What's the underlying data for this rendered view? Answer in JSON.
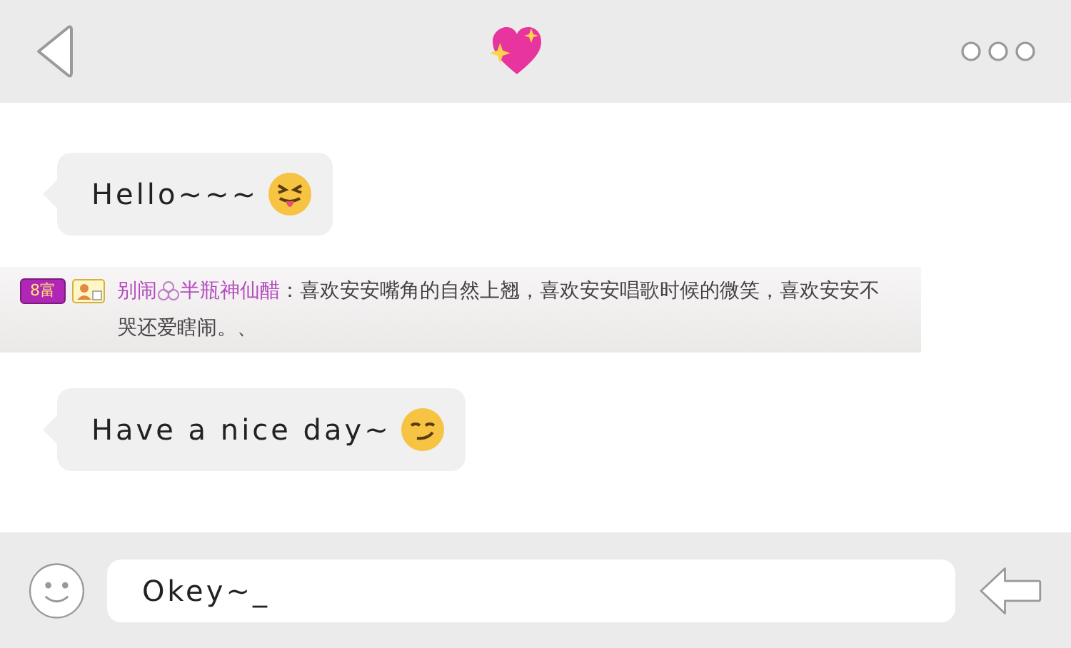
{
  "messages": [
    {
      "kind": "bubble",
      "text": "Hello~~~"
    },
    {
      "kind": "comment",
      "badge": "8富",
      "user": "别闹",
      "nickname": "半瓶神仙醋",
      "text": "：喜欢安安嘴角的自然上翘，喜欢安安唱歌时候的微笑，喜欢安安不哭还爱瞎闹。、"
    },
    {
      "kind": "bubble",
      "text": "Have a nice day~"
    }
  ],
  "input": {
    "value": "Okey~_"
  }
}
